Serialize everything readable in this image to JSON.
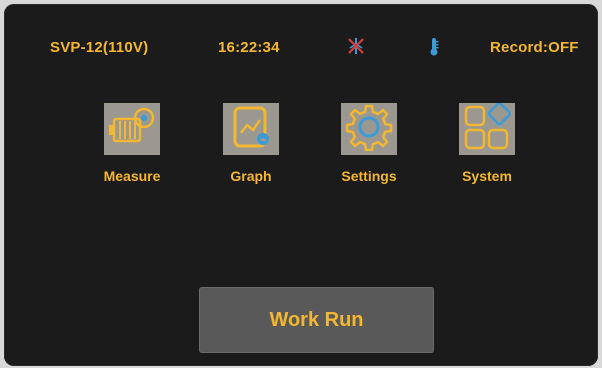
{
  "status_bar": {
    "device_label": "SVP-12(110V)",
    "time": "16:22:34",
    "signal_icon": "no-signal-icon",
    "temperature_icon": "thermometer-icon",
    "record_status": "Record:OFF"
  },
  "menu": [
    {
      "label": "Measure",
      "icon": "motor-icon"
    },
    {
      "label": "Graph",
      "icon": "graph-icon"
    },
    {
      "label": "Settings",
      "icon": "gear-icon"
    },
    {
      "label": "System",
      "icon": "system-grid-icon"
    }
  ],
  "work_run": {
    "label": "Work Run"
  },
  "colors": {
    "accent": "#f4b732",
    "icon_blue": "#3d9bd4",
    "alert_red": "#d63b3b",
    "tile_bg": "#9a9891",
    "screen_bg": "#1b1b1b",
    "button_bg": "#595959"
  }
}
